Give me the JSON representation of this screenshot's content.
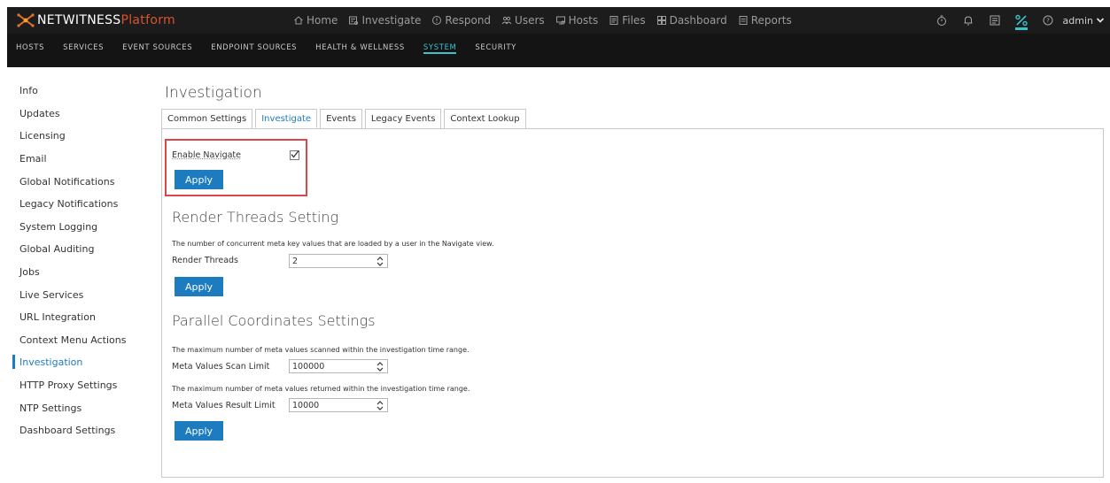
{
  "brand": {
    "name_part1": "NETWITNESS",
    "name_part2": "Platform"
  },
  "main_nav": [
    {
      "label": "Home",
      "icon": "home-icon"
    },
    {
      "label": "Investigate",
      "icon": "investigate-icon"
    },
    {
      "label": "Respond",
      "icon": "respond-icon"
    },
    {
      "label": "Users",
      "icon": "users-icon"
    },
    {
      "label": "Hosts",
      "icon": "hosts-icon"
    },
    {
      "label": "Files",
      "icon": "files-icon"
    },
    {
      "label": "Dashboard",
      "icon": "dashboard-icon"
    },
    {
      "label": "Reports",
      "icon": "reports-icon"
    }
  ],
  "user": {
    "name": "admin"
  },
  "sub_nav": [
    {
      "label": "HOSTS"
    },
    {
      "label": "SERVICES"
    },
    {
      "label": "EVENT SOURCES"
    },
    {
      "label": "ENDPOINT SOURCES"
    },
    {
      "label": "HEALTH & WELLNESS"
    },
    {
      "label": "SYSTEM",
      "active": true
    },
    {
      "label": "SECURITY"
    }
  ],
  "sidebar": [
    {
      "label": "Info"
    },
    {
      "label": "Updates"
    },
    {
      "label": "Licensing"
    },
    {
      "label": "Email"
    },
    {
      "label": "Global Notifications"
    },
    {
      "label": "Legacy Notifications"
    },
    {
      "label": "System Logging"
    },
    {
      "label": "Global Auditing"
    },
    {
      "label": "Jobs"
    },
    {
      "label": "Live Services"
    },
    {
      "label": "URL Integration"
    },
    {
      "label": "Context Menu Actions"
    },
    {
      "label": "Investigation",
      "active": true
    },
    {
      "label": "HTTP Proxy Settings"
    },
    {
      "label": "NTP Settings"
    },
    {
      "label": "Dashboard Settings"
    }
  ],
  "page": {
    "title": "Investigation",
    "tabs": [
      {
        "label": "Common Settings"
      },
      {
        "label": "Investigate",
        "active": true
      },
      {
        "label": "Events"
      },
      {
        "label": "Legacy Events"
      },
      {
        "label": "Context Lookup"
      }
    ]
  },
  "navigate": {
    "label": "Enable Navigate",
    "checked": true,
    "apply": "Apply"
  },
  "render": {
    "heading": "Render Threads Setting",
    "description": "The number of concurrent meta key values that are loaded by a user in the Navigate view.",
    "label": "Render Threads",
    "value": "2",
    "apply": "Apply"
  },
  "parallel": {
    "heading": "Parallel Coordinates Settings",
    "scan_description": "The maximum number of meta values scanned within the investigation time range.",
    "scan_label": "Meta Values Scan Limit",
    "scan_value": "100000",
    "result_description": "The maximum number of meta values returned within the investigation time range.",
    "result_label": "Meta Values Result Limit",
    "result_value": "10000",
    "apply": "Apply"
  },
  "colors": {
    "accent": "#1d7bbf",
    "active_teal": "#3dc0c9",
    "brand_orange": "#d9542b",
    "highlight_red": "#d9474a"
  }
}
